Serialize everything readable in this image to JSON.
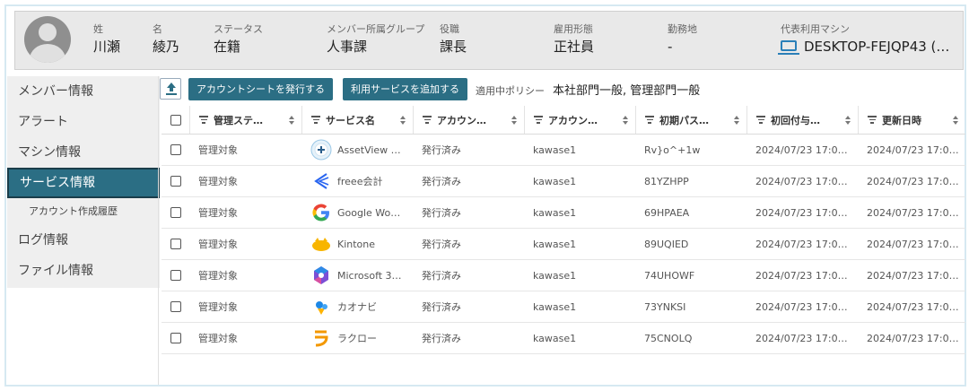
{
  "profile": {
    "surname_label": "姓",
    "surname": "川瀬",
    "given_label": "名",
    "given": "綾乃",
    "status_label": "ステータス",
    "status": "在籍",
    "group_label": "メンバー所属グループ",
    "group": "人事課",
    "role_label": "役職",
    "role": "課長",
    "employment_label": "雇用形態",
    "employment": "正社員",
    "location_label": "勤務地",
    "location": "-",
    "machine_label": "代表利用マシン",
    "machine": "DESKTOP-FEJQP43 (…"
  },
  "sidebar": {
    "items": [
      {
        "label": "メンバー情報"
      },
      {
        "label": "アラート"
      },
      {
        "label": "マシン情報"
      },
      {
        "label": "サービス情報"
      },
      {
        "label": "アカウント作成履歴"
      },
      {
        "label": "ログ情報"
      },
      {
        "label": "ファイル情報"
      }
    ]
  },
  "toolbar": {
    "issue_sheet": "アカウントシートを発行する",
    "add_service": "利用サービスを追加する",
    "policy_label": "適用中ポリシー",
    "policy_value": "本社部門一般, 管理部門一般"
  },
  "table": {
    "headers": [
      "管理ステ…",
      "サービス名",
      "アカウン…",
      "アカウン…",
      "初期パス…",
      "初回付与…",
      "更新日時"
    ],
    "rows": [
      {
        "mgmt": "管理対象",
        "service": "AssetView …",
        "icon": "assetview-icon",
        "issue": "発行済み",
        "account": "kawase1",
        "password": "Rv}o^+1w",
        "first": "2024/07/23 17:0…",
        "updated": "2024/07/23 17:0…"
      },
      {
        "mgmt": "管理対象",
        "service": "freee会計",
        "icon": "freee-icon",
        "issue": "発行済み",
        "account": "kawase1",
        "password": "81YZHPP",
        "first": "2024/07/23 17:0…",
        "updated": "2024/07/23 17:0…"
      },
      {
        "mgmt": "管理対象",
        "service": "Google Wo…",
        "icon": "google-icon",
        "issue": "発行済み",
        "account": "kawase1",
        "password": "69HPAEA",
        "first": "2024/07/23 17:0…",
        "updated": "2024/07/23 17:0…"
      },
      {
        "mgmt": "管理対象",
        "service": "Kintone",
        "icon": "kintone-icon",
        "issue": "発行済み",
        "account": "kawase1",
        "password": "89UQIED",
        "first": "2024/07/23 17:0…",
        "updated": "2024/07/23 17:0…"
      },
      {
        "mgmt": "管理対象",
        "service": "Microsoft 3…",
        "icon": "microsoft-365-icon",
        "issue": "発行済み",
        "account": "kawase1",
        "password": "74UHOWF",
        "first": "2024/07/23 17:0…",
        "updated": "2024/07/23 17:0…"
      },
      {
        "mgmt": "管理対象",
        "service": "カオナビ",
        "icon": "kaonavi-icon",
        "issue": "発行済み",
        "account": "kawase1",
        "password": "73YNKSI",
        "first": "2024/07/23 17:0…",
        "updated": "2024/07/23 17:0…"
      },
      {
        "mgmt": "管理対象",
        "service": "ラクロー",
        "icon": "rakuro-icon",
        "issue": "発行済み",
        "account": "kawase1",
        "password": "75CNOLQ",
        "first": "2024/07/23 17:0…",
        "updated": "2024/07/23 17:0…"
      }
    ]
  },
  "colors": {
    "accent": "#2b6e84",
    "active_border": "#1a3d4a",
    "machine_icon": "#2a7fb8"
  }
}
